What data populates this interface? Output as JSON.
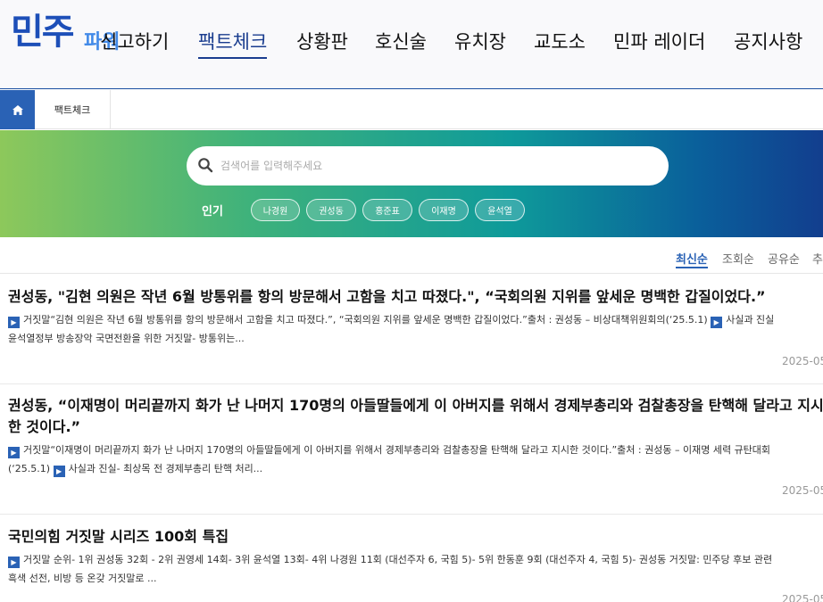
{
  "header": {
    "logo_main": "민주",
    "logo_sub": "파워",
    "nav": [
      {
        "label": "신고하기"
      },
      {
        "label": "팩트체크"
      },
      {
        "label": "상황판"
      },
      {
        "label": "호신술"
      },
      {
        "label": "유치장"
      },
      {
        "label": "교도소"
      },
      {
        "label": "민파 레이더"
      },
      {
        "label": "공지사항"
      }
    ],
    "active_nav": "팩트체크"
  },
  "breadcrumb": {
    "home_icon": "home-icon",
    "current": "팩트체크"
  },
  "search": {
    "placeholder": "검색어를 입력해주세요",
    "value": "",
    "popular_label": "인기",
    "tags": [
      "나경원",
      "권성동",
      "홍준표",
      "이재명",
      "윤석열"
    ]
  },
  "sort": {
    "items": [
      "최신순",
      "조회순",
      "공유순",
      "추"
    ],
    "active": "최신순"
  },
  "articles": [
    {
      "title": "권성동, \"김현 의원은 작년 6월 방통위를 항의 방문해서 고함을 치고 따졌다.\", “국회의원 지위를 앞세운 명백한 갑질이었다.”",
      "summary_1": "거짓말“김현 의원은 작년 6월 방통위를 항의 방문해서 고함을 치고 따졌다.”, “국회의원 지위를 앞세운 명백한 갑질이었다.”출처 : 권성동 – 비상대책위원회의(‘25.5.1)",
      "summary_2": "사실과 진실",
      "summary_3": "윤석열정부 방송장악 국면전환을 위한 거짓말- 방통위는...",
      "date": "2025-05-"
    },
    {
      "title": "권성동, “이재명이 머리끝까지 화가 난 나머지 170명의 아들딸들에게 이 아버지를 위해서 경제부총리와 검찰총장을 탄핵해 달라고 지시한 것이다.”",
      "summary_1": "거짓말“이재명이 머리끝까지 화가 난 나머지 170명의 아들딸들에게 이 아버지를 위해서 경제부총리와 검찰총장을 탄핵해 달라고 지시한 것이다.”출처 : 권성동 – 이재명 세력 규탄대회",
      "summary_2": "(‘25.5.1)",
      "summary_3": "사실과 진실- 최상목 전 경제부총리 탄핵 처리...",
      "date": "2025-05-"
    },
    {
      "title": "국민의힘 거짓말 시리즈 100회 특집",
      "summary_1": "거짓말 순위- 1위 권성동 32회 - 2위 권영세 14회- 3위 윤석열 13회- 4위 나경원 11회 (대선주자 6, 국힘 5)- 5위 한동훈 9회 (대선주자 4, 국힘 5)- 권성동 거짓말: 민주당 후보 관련",
      "summary_2": "흑색 선전, 비방 등 온갖 거짓말로 ...",
      "date": "2025-05-"
    }
  ],
  "colors": {
    "brand": "#1d4fb8",
    "accent": "#2a62b5"
  }
}
